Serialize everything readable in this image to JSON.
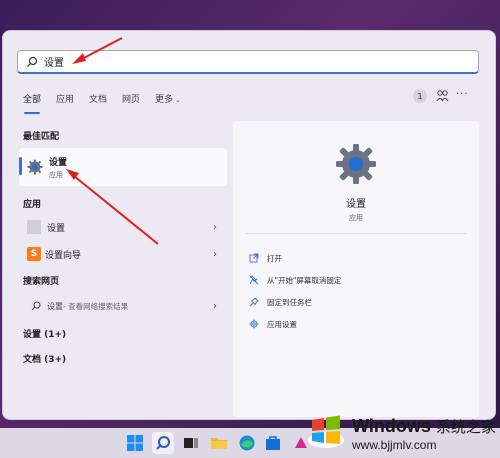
{
  "search": {
    "query": "设置"
  },
  "tabs": [
    {
      "label": "全部",
      "active": true
    },
    {
      "label": "应用"
    },
    {
      "label": "文档"
    },
    {
      "label": "网页"
    },
    {
      "label": "更多"
    }
  ],
  "header_right": {
    "badge_count": "1",
    "people_icon": "people-icon",
    "more_icon": "ellipsis-icon"
  },
  "best_match": {
    "section_label": "最佳匹配",
    "title": "设置",
    "subtitle": "应用",
    "icon": "gear-icon"
  },
  "apps": {
    "section_label": "应用",
    "items": [
      {
        "label": "设置",
        "icon": "blank-app-icon"
      },
      {
        "label": "设置向导",
        "icon": "s-app-icon"
      }
    ]
  },
  "web": {
    "section_label": "搜索网页",
    "item": {
      "query": "设置",
      "suffix": " - 查看网络搜索结果"
    }
  },
  "settings_section": "设置 (1+)",
  "docs_section": "文档 (3+)",
  "detail": {
    "title": "设置",
    "subtitle": "应用",
    "actions": [
      {
        "label": "打开",
        "icon": "open-icon"
      },
      {
        "label": "从\"开始\"屏幕取消固定",
        "icon": "unpin-icon"
      },
      {
        "label": "固定到任务栏",
        "icon": "pin-icon"
      },
      {
        "label": "应用设置",
        "icon": "gear-icon"
      }
    ]
  },
  "watermark": {
    "brand": "Windows",
    "brand_cn": "系统之家",
    "url": "www.bjjmlv.com"
  },
  "colors": {
    "accent": "#3c6fd1",
    "annotation_arrow": "#e02020"
  }
}
